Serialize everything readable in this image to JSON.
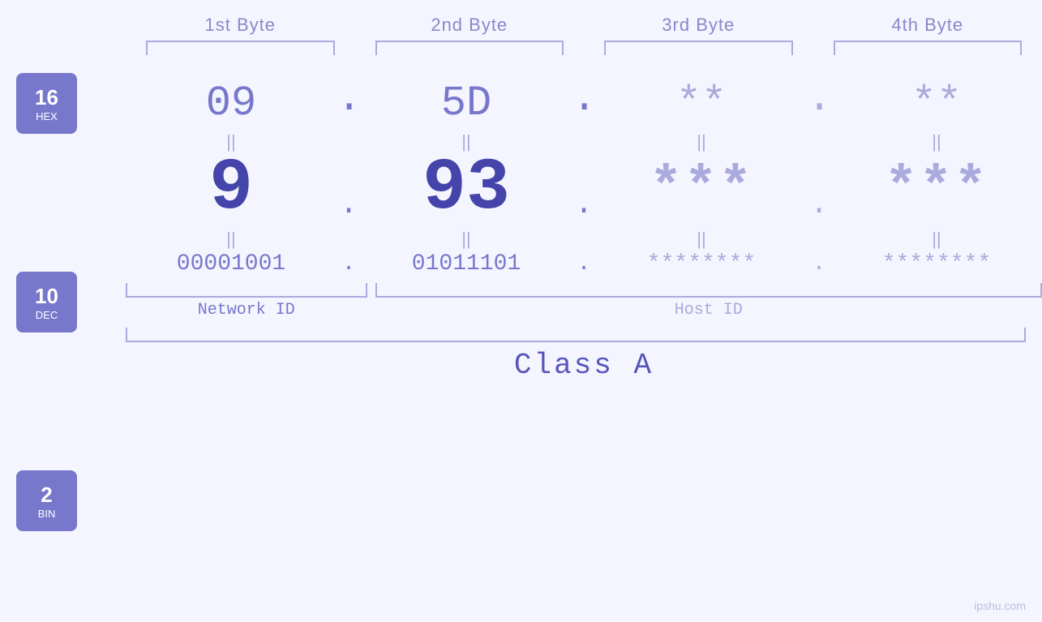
{
  "header": {
    "byte1": "1st Byte",
    "byte2": "2nd Byte",
    "byte3": "3rd Byte",
    "byte4": "4th Byte"
  },
  "badges": {
    "hex": {
      "num": "16",
      "label": "HEX"
    },
    "dec": {
      "num": "10",
      "label": "DEC"
    },
    "bin": {
      "num": "2",
      "label": "BIN"
    }
  },
  "hex_row": {
    "b1": "09",
    "b2": "5D",
    "b3": "**",
    "b4": "**",
    "dots": [
      ".",
      ".",
      ".",
      "."
    ]
  },
  "dec_row": {
    "b1": "9",
    "b2": "93",
    "b3": "***",
    "b4": "***",
    "dots": [
      ".",
      ".",
      ".",
      "."
    ]
  },
  "bin_row": {
    "b1": "00001001",
    "b2": "01011101",
    "b3": "********",
    "b4": "********",
    "dots": [
      ".",
      ".",
      ".",
      "."
    ]
  },
  "equals": "||",
  "network_id_label": "Network ID",
  "host_id_label": "Host ID",
  "class_label": "Class A",
  "watermark": "ipshu.com",
  "colors": {
    "primary": "#7777cc",
    "dark": "#4444aa",
    "light": "#aaaadd",
    "badge_bg": "#7777cc"
  }
}
